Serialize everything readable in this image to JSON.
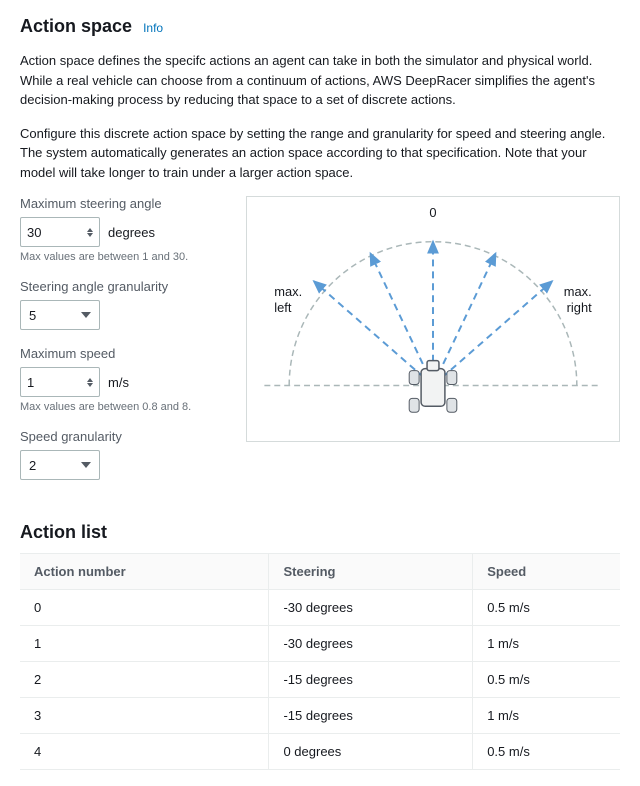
{
  "header": {
    "title": "Action space",
    "info_label": "Info"
  },
  "description": {
    "para1": "Action space defines the specifc actions an agent can take in both the simulator and physical world. While a real vehicle can choose from a continuum of actions, AWS DeepRacer simplifies the agent's decision-making process by reducing that space to a set of discrete actions.",
    "para2": "Configure this discrete action space by setting the range and granularity for speed and steering angle. The system automatically generates an action space according to that specification. Note that your model will take longer to train under a larger action space."
  },
  "form": {
    "max_steering_angle": {
      "label": "Maximum steering angle",
      "value": "30",
      "unit": "degrees",
      "hint": "Max values are between 1 and 30."
    },
    "steering_granularity": {
      "label": "Steering angle granularity",
      "value": "5"
    },
    "max_speed": {
      "label": "Maximum speed",
      "value": "1",
      "unit": "m/s",
      "hint": "Max values are between 0.8 and 8."
    },
    "speed_granularity": {
      "label": "Speed granularity",
      "value": "2"
    }
  },
  "diagram": {
    "top_label": "0",
    "left_label_line1": "max.",
    "left_label_line2": "left",
    "right_label_line1": "max.",
    "right_label_line2": "right"
  },
  "action_list": {
    "title": "Action list",
    "columns": {
      "number": "Action number",
      "steering": "Steering",
      "speed": "Speed"
    },
    "rows": [
      {
        "n": "0",
        "steering": "-30 degrees",
        "speed": "0.5 m/s"
      },
      {
        "n": "1",
        "steering": "-30 degrees",
        "speed": "1 m/s"
      },
      {
        "n": "2",
        "steering": "-15 degrees",
        "speed": "0.5 m/s"
      },
      {
        "n": "3",
        "steering": "-15 degrees",
        "speed": "1 m/s"
      },
      {
        "n": "4",
        "steering": "0 degrees",
        "speed": "0.5 m/s"
      }
    ]
  }
}
